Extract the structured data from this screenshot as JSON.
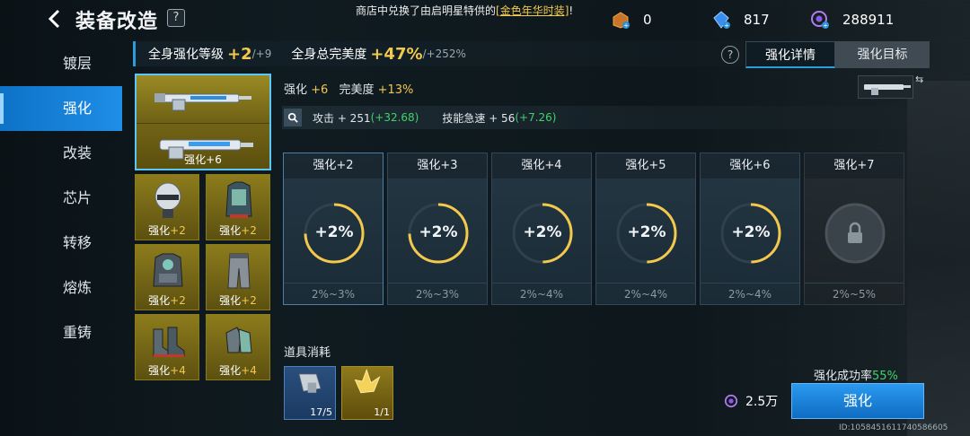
{
  "header": {
    "title": "装备改造",
    "help": "?",
    "notice_prefix": "商店中兑换了由启明星特供的",
    "notice_highlight": "[金色年华时装]",
    "notice_suffix": "!"
  },
  "currencies": [
    {
      "icon": "bronze-chest-icon",
      "value": "0"
    },
    {
      "icon": "blue-gem-icon",
      "value": "817"
    },
    {
      "icon": "purple-orb-icon",
      "value": "288911"
    }
  ],
  "sidenav": {
    "items": [
      {
        "label": "镀层"
      },
      {
        "label": "强化"
      },
      {
        "label": "改装"
      },
      {
        "label": "芯片"
      },
      {
        "label": "转移"
      },
      {
        "label": "熔炼"
      },
      {
        "label": "重铸"
      }
    ],
    "active_index": 1
  },
  "summary": {
    "level_label": "全身强化等级",
    "level_value": "+2",
    "level_max": "/+9",
    "perfect_label": "全身总完美度",
    "perfect_value": "+47%",
    "perfect_max": "/+252%"
  },
  "tabs": {
    "help": "?",
    "detail": "强化详情",
    "target": "强化目标"
  },
  "equipment": {
    "weapon_label_prefix": "强化",
    "weapon_label_value": "+6",
    "slots": [
      {
        "name": "helmet",
        "prefix": "强化",
        "value": "+2"
      },
      {
        "name": "vest",
        "prefix": "强化",
        "value": "+2"
      },
      {
        "name": "armor",
        "prefix": "强化",
        "value": "+2"
      },
      {
        "name": "pants",
        "prefix": "强化",
        "value": "+2"
      },
      {
        "name": "boots",
        "prefix": "强化",
        "value": "+4"
      },
      {
        "name": "gloves",
        "prefix": "强化",
        "value": "+4"
      }
    ]
  },
  "detail": {
    "enhance_label": "强化",
    "enhance_value": "+6",
    "perfect_label": "完美度",
    "perfect_value": "+13%",
    "attack_label": "攻击 + 251",
    "attack_bonus": "(+32.68)",
    "skill_label": "技能急速 + 56",
    "skill_bonus": "(+7.26)"
  },
  "levels": [
    {
      "label": "强化+2",
      "value": "+2%",
      "range": "2%~3%",
      "locked": false
    },
    {
      "label": "强化+3",
      "value": "+2%",
      "range": "2%~3%",
      "locked": false
    },
    {
      "label": "强化+4",
      "value": "+2%",
      "range": "2%~4%",
      "locked": false
    },
    {
      "label": "强化+5",
      "value": "+2%",
      "range": "2%~4%",
      "locked": false
    },
    {
      "label": "强化+6",
      "value": "+2%",
      "range": "2%~4%",
      "locked": false
    },
    {
      "label": "强化+7",
      "value": "",
      "range": "2%~5%",
      "locked": true
    }
  ],
  "consume": {
    "title": "道具消耗",
    "items": [
      {
        "icon": "metal-part-icon",
        "count": "17/5"
      },
      {
        "icon": "yellow-crystal-icon",
        "count": "1/1"
      }
    ]
  },
  "action": {
    "rate_label": "强化成功率",
    "rate_value": "55%",
    "cost": "2.5万",
    "button": "强化",
    "uid": "ID:1058451611740586605"
  },
  "colors": {
    "accent_blue": "#1f8ee6",
    "gold": "#f2c94c",
    "green": "#41d36a"
  }
}
